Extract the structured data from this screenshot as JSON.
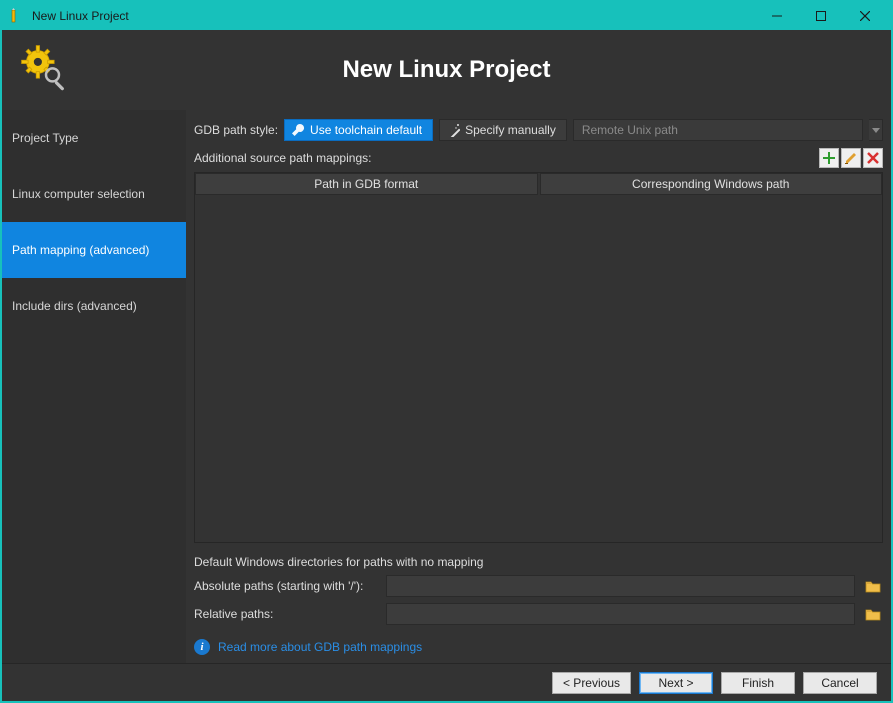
{
  "window": {
    "title": "New Linux Project"
  },
  "banner": {
    "title": "New Linux Project"
  },
  "sidebar": {
    "items": [
      {
        "label": "Project Type"
      },
      {
        "label": "Linux computer selection"
      },
      {
        "label": "Path mapping (advanced)",
        "selected": true
      },
      {
        "label": "Include dirs (advanced)"
      }
    ]
  },
  "main": {
    "gdb_path_style_label": "GDB path style:",
    "toolchain_default_label": "Use toolchain default",
    "specify_manually_label": "Specify manually",
    "remote_placeholder": "Remote Unix path",
    "additional_mappings_label": "Additional source path mappings:",
    "table": {
      "col1": "Path in GDB format",
      "col2": "Corresponding Windows path"
    },
    "defaults_heading": "Default Windows directories for paths with no mapping",
    "absolute_label": "Absolute paths (starting with '/'):",
    "relative_label": "Relative paths:",
    "info_link": "Read more about GDB path mappings"
  },
  "footer": {
    "previous": "< Previous",
    "next": "Next >",
    "finish": "Finish",
    "cancel": "Cancel"
  }
}
